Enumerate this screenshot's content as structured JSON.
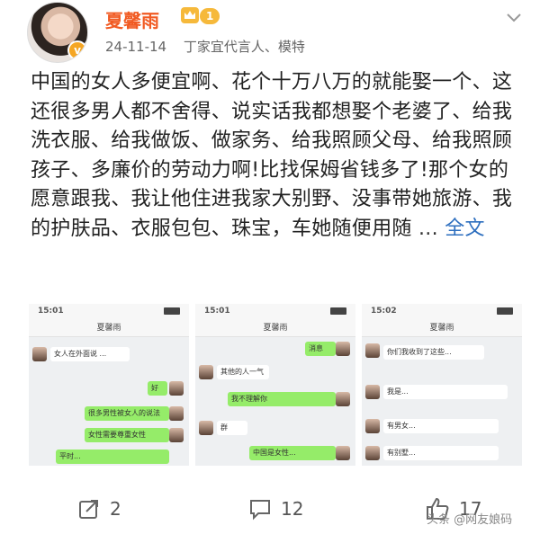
{
  "post": {
    "author": "夏馨雨",
    "level": "1",
    "date": "24-11-14",
    "bio": "丁家宜代言人、模特",
    "text": "中国的女人多便宜啊、花个十万八万的就能娶一个、这还很多男人都不舍得、说实话我都想娶个老婆了、给我洗衣服、给我做饭、做家务、给我照顾父母、给我照顾孩子、多廉价的劳动力啊!比找保姆省钱多了!那个女的愿意跟我、我让他住进我家大别野、没事带她旅游、我的护肤品、衣服包包、珠宝，车她随便用随",
    "ellipsis": "...",
    "full_text_link": "全文"
  },
  "screenshots": [
    {
      "time": "15:01",
      "title": "夏馨雨",
      "messages": [
        "女人在外面说 ...",
        "好",
        "很多男性被女人的说法",
        "女性需要尊重女性",
        "平时..."
      ]
    },
    {
      "time": "15:01",
      "title": "夏馨雨",
      "messages": [
        "消息",
        "其他的人一气",
        "我不理解你",
        "群",
        "中国是女性..."
      ]
    },
    {
      "time": "15:02",
      "title": "夏馨雨",
      "messages": [
        "你们我收到了这些...",
        "我是...",
        "有男女...",
        "有别墅..."
      ]
    }
  ],
  "actions": {
    "share_count": "2",
    "comment_count": "12",
    "like_count": "17"
  },
  "watermark": "头条 @网友娘码"
}
